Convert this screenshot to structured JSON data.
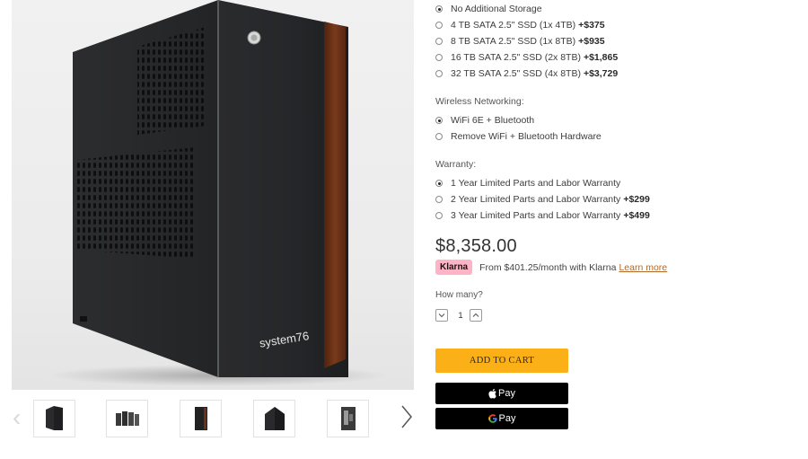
{
  "product": {
    "brand_mark": "system76"
  },
  "options": {
    "storage": {
      "items": [
        {
          "label": "No Additional Storage",
          "price": "",
          "selected": true
        },
        {
          "label": "4 TB SATA 2.5\" SSD (1x 4TB)",
          "price": "+$375",
          "selected": false
        },
        {
          "label": "8 TB SATA 2.5\" SSD (1x 8TB)",
          "price": "+$935",
          "selected": false
        },
        {
          "label": "16 TB SATA 2.5\" SSD (2x 8TB)",
          "price": "+$1,865",
          "selected": false
        },
        {
          "label": "32 TB SATA 2.5\" SSD (4x 8TB)",
          "price": "+$3,729",
          "selected": false
        }
      ]
    },
    "wireless": {
      "label": "Wireless Networking:",
      "items": [
        {
          "label": "WiFi 6E + Bluetooth",
          "price": "",
          "selected": true
        },
        {
          "label": "Remove WiFi + Bluetooth Hardware",
          "price": "",
          "selected": false
        }
      ]
    },
    "warranty": {
      "label": "Warranty:",
      "items": [
        {
          "label": "1 Year Limited Parts and Labor Warranty",
          "price": "",
          "selected": true
        },
        {
          "label": "2 Year Limited Parts and Labor Warranty",
          "price": "+$299",
          "selected": false
        },
        {
          "label": "3 Year Limited Parts and Labor Warranty",
          "price": "+$499",
          "selected": false
        }
      ]
    }
  },
  "pricing": {
    "total": "$8,358.00",
    "klarna_badge": "Klarna",
    "klarna_text": "From $401.25/month with Klarna",
    "klarna_link": "Learn more"
  },
  "quantity": {
    "label": "How many?",
    "value": "1"
  },
  "actions": {
    "add_to_cart": "ADD TO CART",
    "apple_pay": "Pay",
    "google_pay": "Pay"
  },
  "colors": {
    "add_to_cart_bg": "#fbb017",
    "klarna_pink": "#ffb3c7",
    "wood": "#6b3218"
  }
}
